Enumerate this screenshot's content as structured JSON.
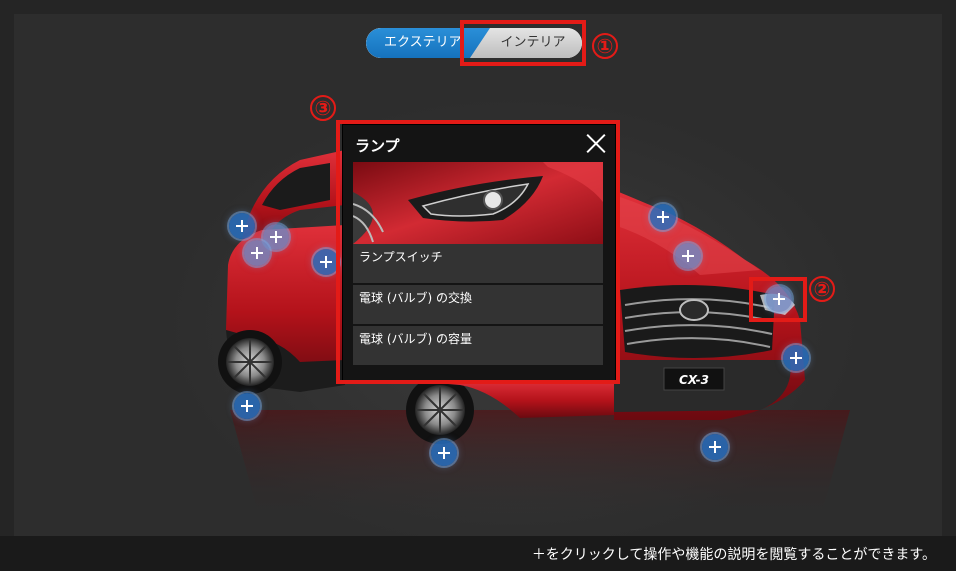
{
  "view_toggle": {
    "exterior_label": "エクステリア",
    "interior_label": "インテリア",
    "selected": "exterior"
  },
  "popup": {
    "title": "ランプ",
    "items": [
      {
        "label": "ランプスイッチ"
      },
      {
        "label": "電球 (バルブ) の交換"
      },
      {
        "label": "電球 (バルブ) の容量"
      }
    ]
  },
  "annotations": {
    "one": "①",
    "two": "②",
    "three": "③"
  },
  "car": {
    "badge": "CX-3",
    "body_color": "#c8151d"
  },
  "footer": {
    "hint": "＋をクリックして操作や機能の説明を閲覧することができます。"
  },
  "colors": {
    "accent": "#1a7fcf",
    "annotation": "#e31b17",
    "hotspot": "#2a6ebe"
  },
  "icons": {
    "hotspot": "plus-icon",
    "close": "close-icon"
  }
}
